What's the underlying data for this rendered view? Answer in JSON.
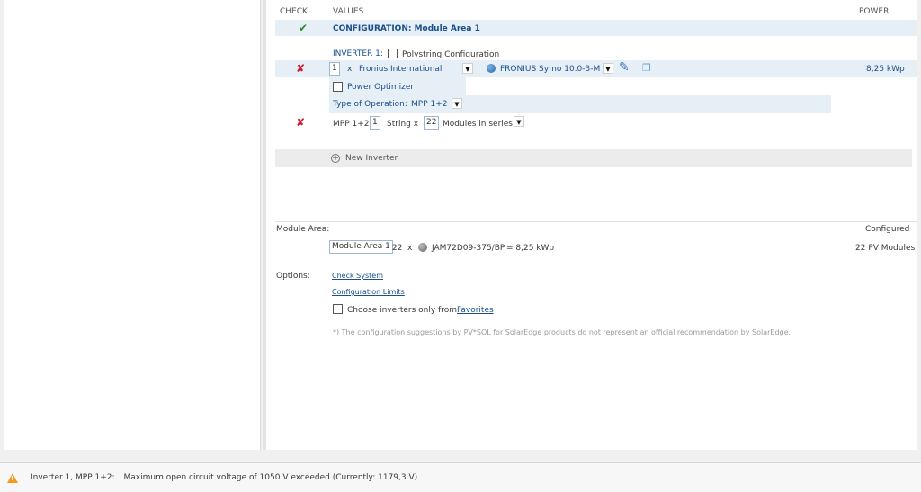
{
  "columns": {
    "check": "CHECK",
    "values": "VALUES",
    "power": "POWER"
  },
  "configuration": {
    "title": "CONFIGURATION: Module Area 1"
  },
  "inverter": {
    "label": "INVERTER 1:",
    "polystring_label": "Polystring Configuration",
    "count": "1",
    "x": "x",
    "manufacturer": "Fronius International",
    "model": "FRONIUS Symo 10.0-3-M",
    "power": "8,25 kWp",
    "power_optimizer_label": "Power Optimizer",
    "type_of_operation_label": "Type of Operation:",
    "type_of_operation_value": "MPP 1+2"
  },
  "mpp": {
    "label": "MPP 1+2:",
    "strings": "1",
    "string_x": "String x",
    "modules": "22",
    "modules_label": "Modules in series"
  },
  "new_inverter": "New Inverter",
  "module_area": {
    "label": "Module Area:",
    "configured_label": "Configured",
    "name": "Module Area 1",
    "count": "22",
    "x": "x",
    "module": "JAM72D09-375/BP",
    "equals": "= 8,25 kWp",
    "configured_value": "22 PV Modules"
  },
  "options": {
    "label": "Options:",
    "check_system": "Check System",
    "config_limits": "Configuration Limits",
    "choose_text": "Choose inverters only from",
    "favorites": "Favorites",
    "note": "*) The configuration suggestions by PV*SOL for SolarEdge products do not represent an official recommendation by SolarEdge."
  },
  "status": {
    "source": "Inverter 1, MPP 1+2:",
    "message": "Maximum open circuit voltage of 1050 V exceeded (Currently: 1179,3 V)"
  },
  "colors": {
    "accent": "#1a4f8c",
    "band": "#e6eef6",
    "error": "#d0182b",
    "ok": "#2e8b2e",
    "warning": "#f39a1d"
  }
}
